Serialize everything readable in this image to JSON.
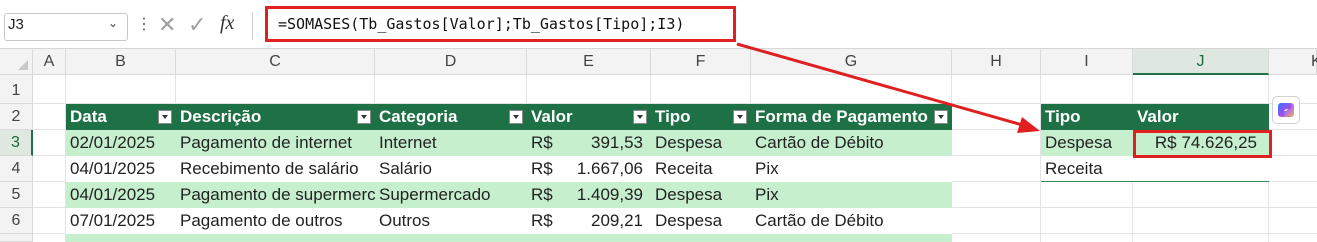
{
  "formula_bar": {
    "name_box": "J3",
    "name_box_arrow": "⌄",
    "menu_dots": "⋮",
    "cancel_icon": "✕",
    "enter_icon": "✓",
    "fx_label": "fx",
    "formula": "=SOMASES(Tb_Gastos[Valor];Tb_Gastos[Tipo];I3)"
  },
  "columns": [
    "A",
    "B",
    "C",
    "D",
    "E",
    "F",
    "G",
    "H",
    "I",
    "J",
    "K"
  ],
  "selected_column": "J",
  "rows": [
    "1",
    "2",
    "3",
    "4",
    "5",
    "6"
  ],
  "selected_row": "3",
  "table": {
    "headers": [
      "Data",
      "Descrição",
      "Categoria",
      "Valor",
      "Tipo",
      "Forma de Pagamento"
    ],
    "currency": "R$",
    "rows": [
      {
        "data": "02/01/2025",
        "descricao": "Pagamento de internet",
        "categoria": "Internet",
        "valor": "391,53",
        "tipo": "Despesa",
        "forma": "Cartão de Débito"
      },
      {
        "data": "04/01/2025",
        "descricao": "Recebimento de salário",
        "categoria": "Salário",
        "valor": "1.667,06",
        "tipo": "Receita",
        "forma": "Pix"
      },
      {
        "data": "04/01/2025",
        "descricao": "Pagamento de supermercado",
        "categoria": "Supermercado",
        "valor": "1.409,39",
        "tipo": "Despesa",
        "forma": "Pix"
      },
      {
        "data": "07/01/2025",
        "descricao": "Pagamento de outros",
        "categoria": "Outros",
        "valor": "209,21",
        "tipo": "Despesa",
        "forma": "Cartão de Débito"
      }
    ]
  },
  "summary": {
    "headers": [
      "Tipo",
      "Valor"
    ],
    "rows": [
      {
        "tipo": "Despesa",
        "valor": "R$ 74.626,25"
      },
      {
        "tipo": "Receita",
        "valor": ""
      }
    ]
  },
  "colors": {
    "header_green": "#1e7145",
    "band_green": "#c6efce",
    "highlight_red": "#e02020"
  },
  "icons": [
    "chevron-down-icon",
    "more-icon",
    "cancel-icon",
    "enter-icon",
    "fx-icon",
    "filter-dropdown-icon",
    "copilot-icon"
  ]
}
